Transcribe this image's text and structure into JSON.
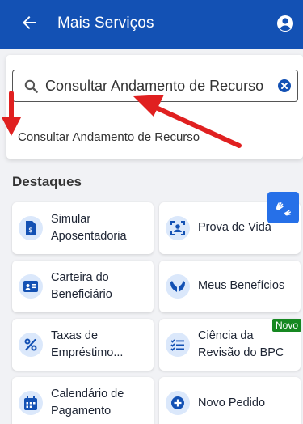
{
  "header": {
    "title": "Mais Serviços",
    "back_icon": "arrow-left-icon",
    "user_icon": "user-circle-icon",
    "bg_color": "#1351b4"
  },
  "search": {
    "value": "Consultar Andamento de Recurso",
    "search_icon": "search-icon",
    "clear_icon": "clear-circle-icon"
  },
  "suggestions": [
    {
      "label": "Consultar Andamento de Recurso"
    }
  ],
  "highlights": {
    "title": "Destaques",
    "cards": [
      {
        "label": "Simular Aposentadoria",
        "icon": "document-money-icon"
      },
      {
        "label": "Prova de Vida",
        "icon": "face-scan-icon"
      },
      {
        "label": "Carteira do Beneficiário",
        "icon": "id-card-icon"
      },
      {
        "label": "Meus Benefícios",
        "icon": "hands-care-icon"
      },
      {
        "label": "Taxas de Empréstimo...",
        "icon": "percent-icon"
      },
      {
        "label": "Ciência da Revisão do BPC",
        "icon": "checklist-icon",
        "badge": "Novo"
      },
      {
        "label": "Calendário de Pagamento",
        "icon": "calendar-icon"
      },
      {
        "label": "Novo Pedido",
        "icon": "plus-circle-icon"
      }
    ]
  },
  "accessibility": {
    "icon": "sign-language-hands-icon",
    "color": "#2670e8"
  },
  "annotation_color": "#e02020"
}
